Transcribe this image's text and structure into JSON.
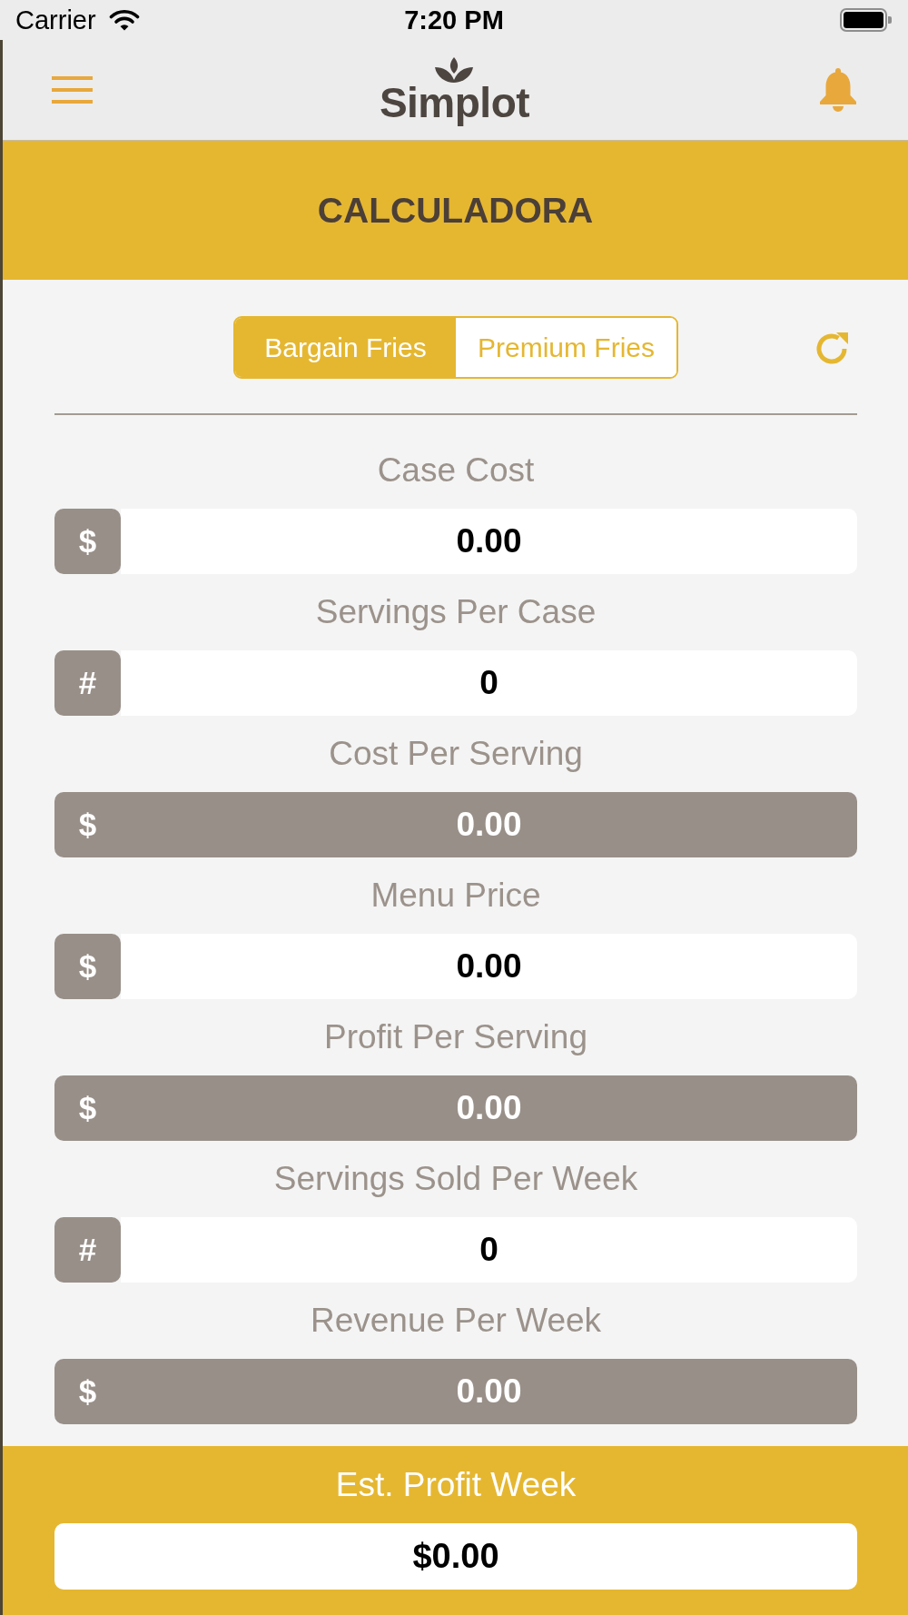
{
  "status_bar": {
    "carrier": "Carrier",
    "time": "7:20 PM"
  },
  "nav_bar": {
    "logo": "Simplot"
  },
  "header": {
    "title": "CALCULADORA"
  },
  "segments": [
    {
      "label": "Bargain Fries",
      "selected": true
    },
    {
      "label": "Premium Fries",
      "selected": false
    }
  ],
  "fields": [
    {
      "kind": "input",
      "label": "Case Cost",
      "prefix": "$",
      "value": "0.00"
    },
    {
      "kind": "input",
      "label": "Servings Per Case",
      "prefix": "#",
      "value": "0"
    },
    {
      "kind": "result",
      "label": "Cost Per Serving",
      "prefix": "$",
      "value": "0.00"
    },
    {
      "kind": "input",
      "label": "Menu Price",
      "prefix": "$",
      "value": "0.00"
    },
    {
      "kind": "result",
      "label": "Profit Per Serving",
      "prefix": "$",
      "value": "0.00"
    },
    {
      "kind": "input",
      "label": "Servings Sold Per Week",
      "prefix": "#",
      "value": "0"
    },
    {
      "kind": "result",
      "label": "Revenue Per Week",
      "prefix": "$",
      "value": "0.00"
    }
  ],
  "total": {
    "label": "Est. Profit Week",
    "value": "$0.00"
  }
}
